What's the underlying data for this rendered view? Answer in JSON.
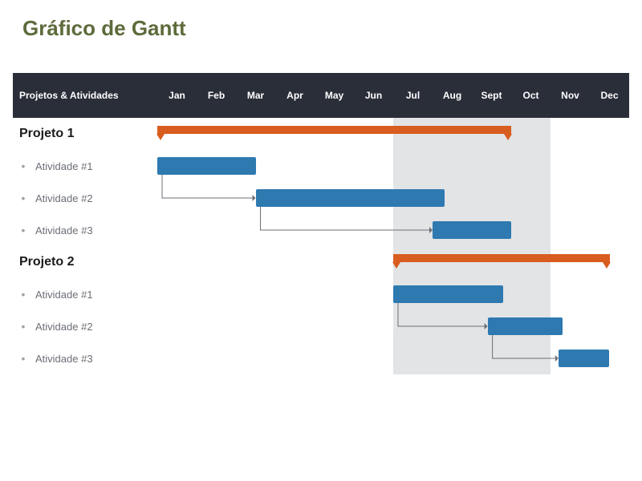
{
  "title": "Gráfico de Gantt",
  "header_label": "Projetos & Atividades",
  "months": [
    "Jan",
    "Feb",
    "Mar",
    "Apr",
    "May",
    "Jun",
    "Jul",
    "Aug",
    "Sept",
    "Oct",
    "Nov",
    "Dec"
  ],
  "projects": [
    {
      "name": "Projeto 1",
      "activities": [
        "Atividade #1",
        "Atividade #2",
        "Atividade #3"
      ]
    },
    {
      "name": "Projeto 2",
      "activities": [
        "Atividade #1",
        "Atividade #2",
        "Atividade #3"
      ]
    }
  ],
  "chart_data": {
    "type": "gantt",
    "title": "Gráfico de Gantt",
    "x_categories": [
      "Jan",
      "Feb",
      "Mar",
      "Apr",
      "May",
      "Jun",
      "Jul",
      "Aug",
      "Sept",
      "Oct",
      "Nov",
      "Dec"
    ],
    "groups": [
      {
        "name": "Projeto 1",
        "summary": {
          "start": 1,
          "end": 10
        },
        "tasks": [
          {
            "name": "Atividade #1",
            "start": 1,
            "end": 3.5
          },
          {
            "name": "Atividade #2",
            "start": 3.5,
            "end": 8.3
          },
          {
            "name": "Atividade #3",
            "start": 8,
            "end": 10
          }
        ],
        "dependencies": [
          {
            "from": "Atividade #1",
            "to": "Atividade #2"
          },
          {
            "from": "Atividade #2",
            "to": "Atividade #3"
          }
        ]
      },
      {
        "name": "Projeto 2",
        "summary": {
          "start": 7,
          "end": 12.5
        },
        "tasks": [
          {
            "name": "Atividade #1",
            "start": 7,
            "end": 9.8
          },
          {
            "name": "Atividade #2",
            "start": 9.4,
            "end": 11.3
          },
          {
            "name": "Atividade #3",
            "start": 11.2,
            "end": 12.5
          }
        ],
        "dependencies": [
          {
            "from": "Atividade #1",
            "to": "Atividade #2"
          },
          {
            "from": "Atividade #2",
            "to": "Atividade #3"
          }
        ]
      }
    ],
    "highlight_range": {
      "start": 7,
      "end": 10
    },
    "colors": {
      "task": "#2e79b0",
      "summary": "#d85d1e",
      "header_bg": "#2a2e39"
    }
  }
}
